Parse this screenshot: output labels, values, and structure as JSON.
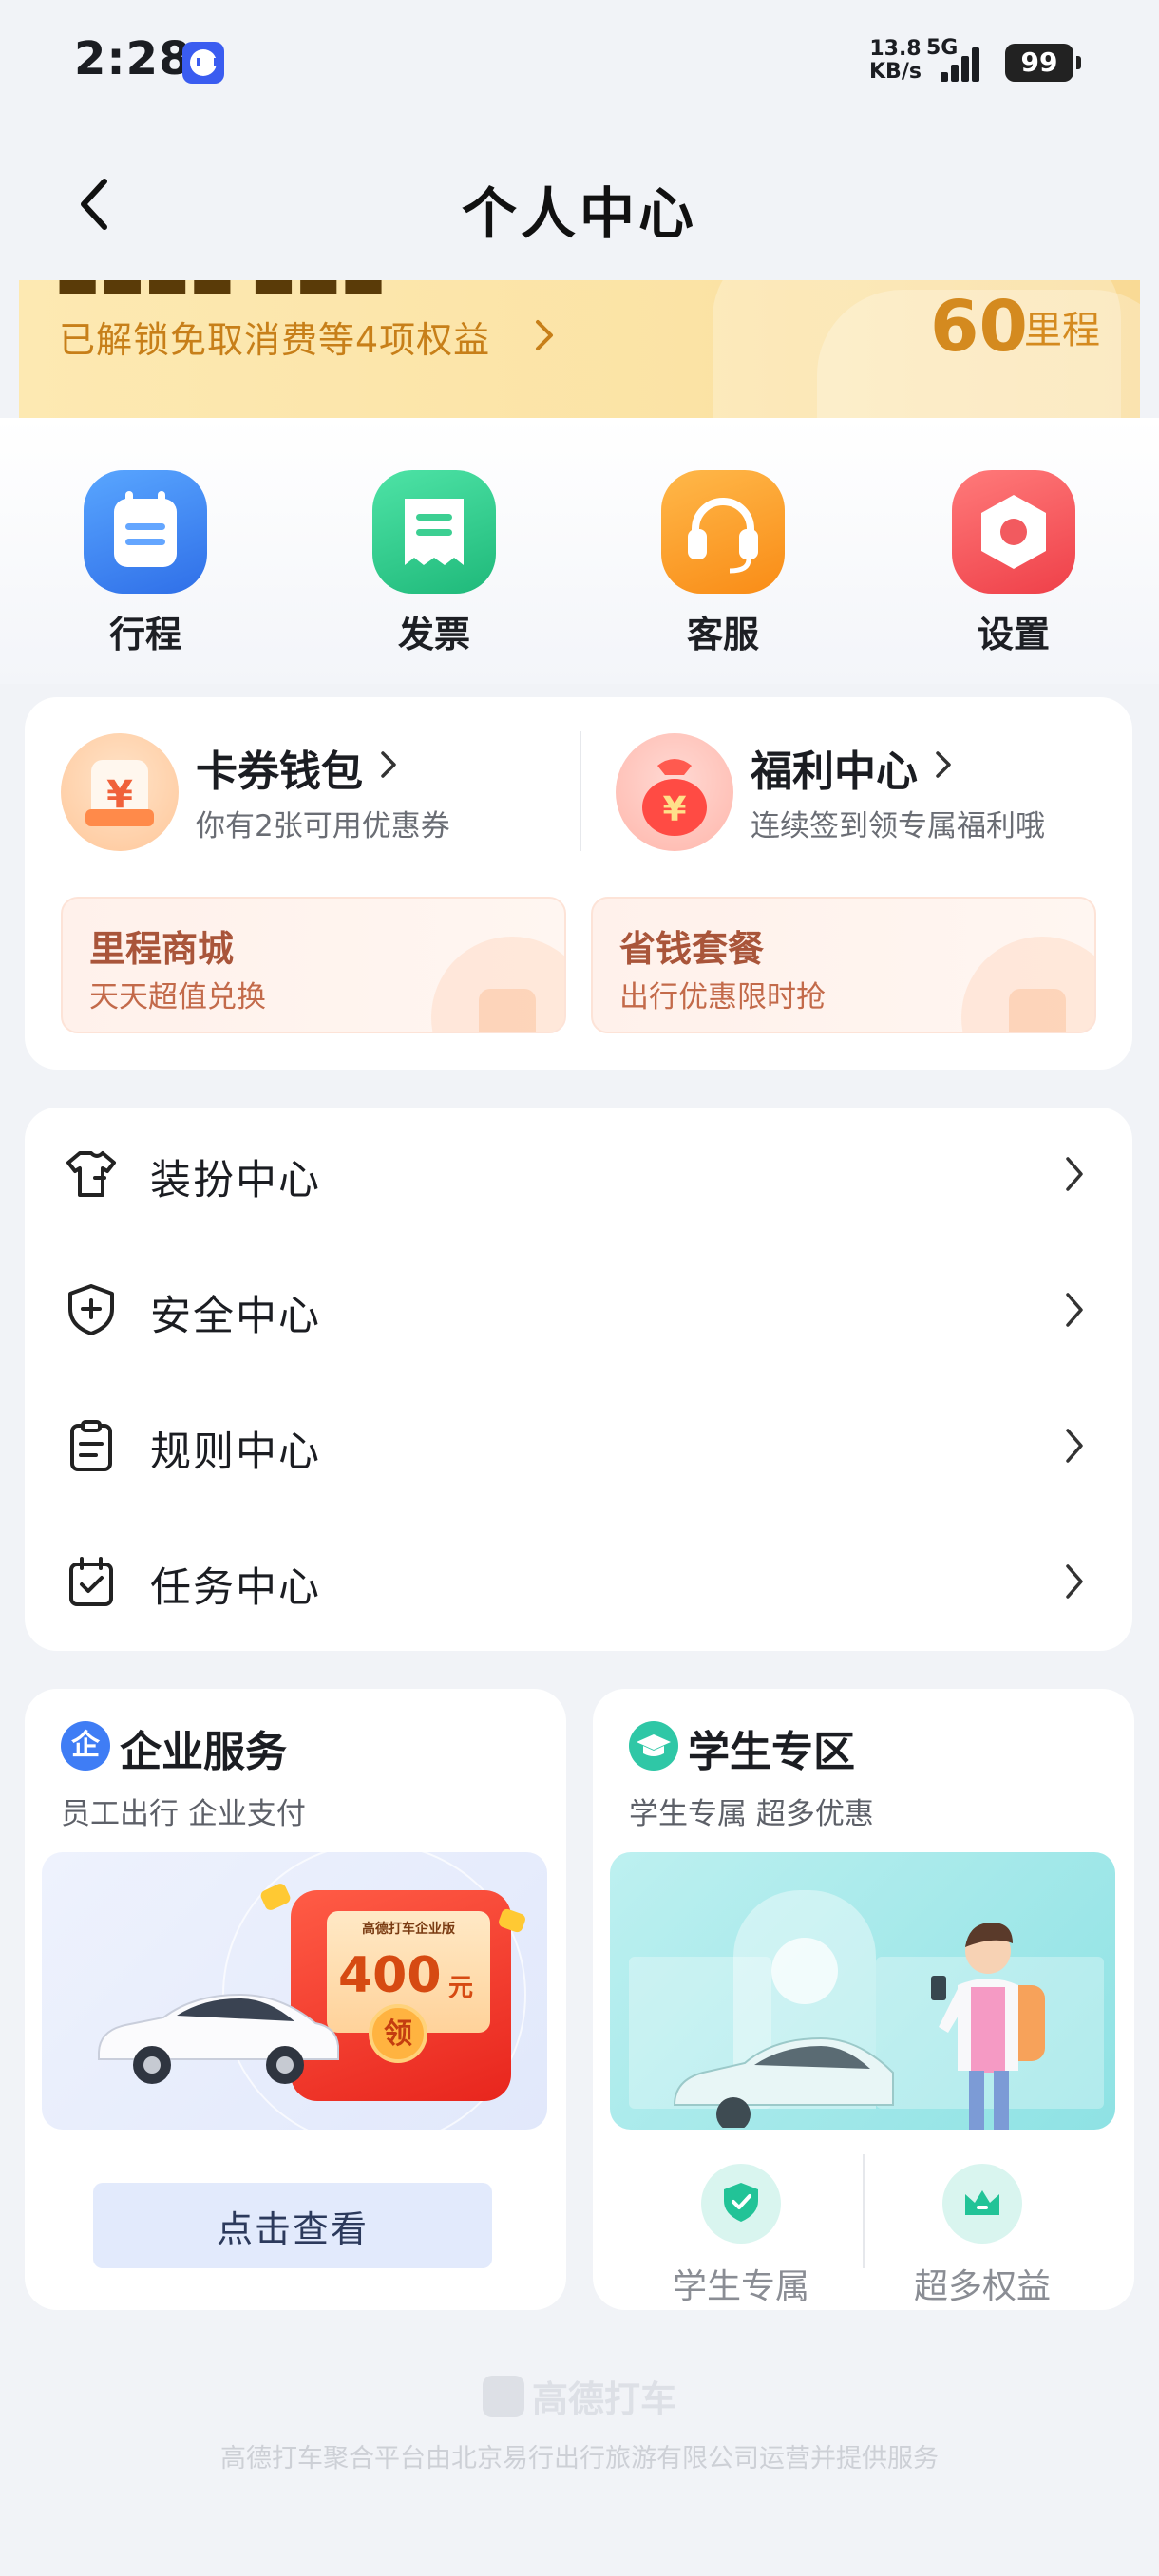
{
  "status_bar": {
    "time": "2:28",
    "net_speed_value": "13.8",
    "net_speed_unit": "KB/s",
    "network": "5G",
    "battery": "99"
  },
  "nav": {
    "title": "个人中心"
  },
  "banner": {
    "subtitle": "已解锁免取消费等4项权益",
    "miles_value": "60",
    "miles_unit": "里程"
  },
  "quick_actions": [
    {
      "label": "行程",
      "icon": "calendar-icon",
      "color": "#3f8cf4"
    },
    {
      "label": "发票",
      "icon": "receipt-icon",
      "color": "#2fcf8e"
    },
    {
      "label": "客服",
      "icon": "headset-icon",
      "color": "#fb9a22"
    },
    {
      "label": "设置",
      "icon": "settings-icon",
      "color": "#f6575a"
    }
  ],
  "wallet": {
    "coupons": {
      "title": "卡券钱包",
      "desc": "你有2张可用优惠券"
    },
    "welfare": {
      "title": "福利中心",
      "desc": "连续签到领专属福利哦"
    },
    "mileage_mall": {
      "title": "里程商城",
      "sub": "天天超值兑换"
    },
    "saving_pack": {
      "title": "省钱套餐",
      "sub": "出行优惠限时抢"
    }
  },
  "menu": [
    {
      "label": "装扮中心",
      "icon": "shirt-icon"
    },
    {
      "label": "安全中心",
      "icon": "shield-icon"
    },
    {
      "label": "规则中心",
      "icon": "clipboard-icon"
    },
    {
      "label": "任务中心",
      "icon": "task-calendar-icon"
    }
  ],
  "enterprise": {
    "title": "企业服务",
    "badge": "企",
    "subtitle": "员工出行 企业支付",
    "envelope_tag": "高德打车企业版",
    "envelope_amount": "400",
    "envelope_unit": "元",
    "envelope_coin": "领",
    "button": "点击查看"
  },
  "student": {
    "title": "学生专区",
    "subtitle": "学生专属 超多优惠",
    "features": [
      {
        "label": "学生专属",
        "icon": "shield-check-icon"
      },
      {
        "label": "超多权益",
        "icon": "crown-icon"
      }
    ]
  },
  "footer": {
    "logo_text": "高德打车",
    "note": "高德打车聚合平台由北京易行出行旅游有限公司运营并提供服务"
  }
}
